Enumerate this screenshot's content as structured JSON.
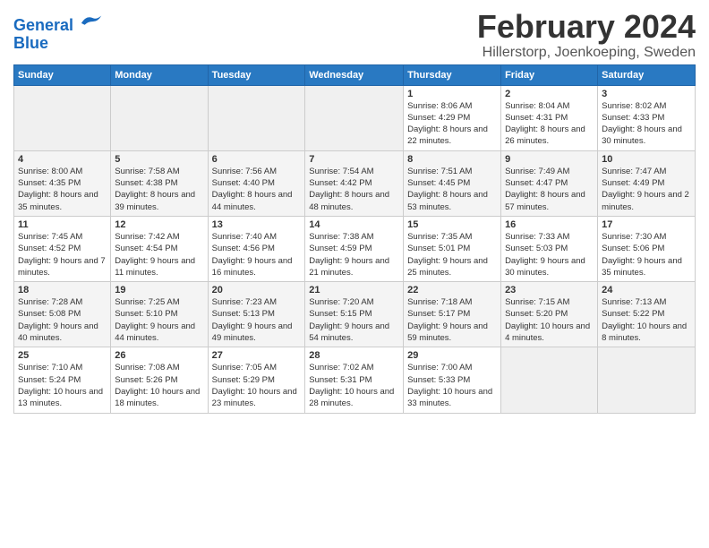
{
  "header": {
    "logo_line1": "General",
    "logo_line2": "Blue",
    "title": "February 2024",
    "subtitle": "Hillerstorp, Joenkoeping, Sweden"
  },
  "days_of_week": [
    "Sunday",
    "Monday",
    "Tuesday",
    "Wednesday",
    "Thursday",
    "Friday",
    "Saturday"
  ],
  "weeks": [
    [
      {
        "day": "",
        "sunrise": "",
        "sunset": "",
        "daylight": ""
      },
      {
        "day": "",
        "sunrise": "",
        "sunset": "",
        "daylight": ""
      },
      {
        "day": "",
        "sunrise": "",
        "sunset": "",
        "daylight": ""
      },
      {
        "day": "",
        "sunrise": "",
        "sunset": "",
        "daylight": ""
      },
      {
        "day": "1",
        "sunrise": "Sunrise: 8:06 AM",
        "sunset": "Sunset: 4:29 PM",
        "daylight": "Daylight: 8 hours and 22 minutes."
      },
      {
        "day": "2",
        "sunrise": "Sunrise: 8:04 AM",
        "sunset": "Sunset: 4:31 PM",
        "daylight": "Daylight: 8 hours and 26 minutes."
      },
      {
        "day": "3",
        "sunrise": "Sunrise: 8:02 AM",
        "sunset": "Sunset: 4:33 PM",
        "daylight": "Daylight: 8 hours and 30 minutes."
      }
    ],
    [
      {
        "day": "4",
        "sunrise": "Sunrise: 8:00 AM",
        "sunset": "Sunset: 4:35 PM",
        "daylight": "Daylight: 8 hours and 35 minutes."
      },
      {
        "day": "5",
        "sunrise": "Sunrise: 7:58 AM",
        "sunset": "Sunset: 4:38 PM",
        "daylight": "Daylight: 8 hours and 39 minutes."
      },
      {
        "day": "6",
        "sunrise": "Sunrise: 7:56 AM",
        "sunset": "Sunset: 4:40 PM",
        "daylight": "Daylight: 8 hours and 44 minutes."
      },
      {
        "day": "7",
        "sunrise": "Sunrise: 7:54 AM",
        "sunset": "Sunset: 4:42 PM",
        "daylight": "Daylight: 8 hours and 48 minutes."
      },
      {
        "day": "8",
        "sunrise": "Sunrise: 7:51 AM",
        "sunset": "Sunset: 4:45 PM",
        "daylight": "Daylight: 8 hours and 53 minutes."
      },
      {
        "day": "9",
        "sunrise": "Sunrise: 7:49 AM",
        "sunset": "Sunset: 4:47 PM",
        "daylight": "Daylight: 8 hours and 57 minutes."
      },
      {
        "day": "10",
        "sunrise": "Sunrise: 7:47 AM",
        "sunset": "Sunset: 4:49 PM",
        "daylight": "Daylight: 9 hours and 2 minutes."
      }
    ],
    [
      {
        "day": "11",
        "sunrise": "Sunrise: 7:45 AM",
        "sunset": "Sunset: 4:52 PM",
        "daylight": "Daylight: 9 hours and 7 minutes."
      },
      {
        "day": "12",
        "sunrise": "Sunrise: 7:42 AM",
        "sunset": "Sunset: 4:54 PM",
        "daylight": "Daylight: 9 hours and 11 minutes."
      },
      {
        "day": "13",
        "sunrise": "Sunrise: 7:40 AM",
        "sunset": "Sunset: 4:56 PM",
        "daylight": "Daylight: 9 hours and 16 minutes."
      },
      {
        "day": "14",
        "sunrise": "Sunrise: 7:38 AM",
        "sunset": "Sunset: 4:59 PM",
        "daylight": "Daylight: 9 hours and 21 minutes."
      },
      {
        "day": "15",
        "sunrise": "Sunrise: 7:35 AM",
        "sunset": "Sunset: 5:01 PM",
        "daylight": "Daylight: 9 hours and 25 minutes."
      },
      {
        "day": "16",
        "sunrise": "Sunrise: 7:33 AM",
        "sunset": "Sunset: 5:03 PM",
        "daylight": "Daylight: 9 hours and 30 minutes."
      },
      {
        "day": "17",
        "sunrise": "Sunrise: 7:30 AM",
        "sunset": "Sunset: 5:06 PM",
        "daylight": "Daylight: 9 hours and 35 minutes."
      }
    ],
    [
      {
        "day": "18",
        "sunrise": "Sunrise: 7:28 AM",
        "sunset": "Sunset: 5:08 PM",
        "daylight": "Daylight: 9 hours and 40 minutes."
      },
      {
        "day": "19",
        "sunrise": "Sunrise: 7:25 AM",
        "sunset": "Sunset: 5:10 PM",
        "daylight": "Daylight: 9 hours and 44 minutes."
      },
      {
        "day": "20",
        "sunrise": "Sunrise: 7:23 AM",
        "sunset": "Sunset: 5:13 PM",
        "daylight": "Daylight: 9 hours and 49 minutes."
      },
      {
        "day": "21",
        "sunrise": "Sunrise: 7:20 AM",
        "sunset": "Sunset: 5:15 PM",
        "daylight": "Daylight: 9 hours and 54 minutes."
      },
      {
        "day": "22",
        "sunrise": "Sunrise: 7:18 AM",
        "sunset": "Sunset: 5:17 PM",
        "daylight": "Daylight: 9 hours and 59 minutes."
      },
      {
        "day": "23",
        "sunrise": "Sunrise: 7:15 AM",
        "sunset": "Sunset: 5:20 PM",
        "daylight": "Daylight: 10 hours and 4 minutes."
      },
      {
        "day": "24",
        "sunrise": "Sunrise: 7:13 AM",
        "sunset": "Sunset: 5:22 PM",
        "daylight": "Daylight: 10 hours and 8 minutes."
      }
    ],
    [
      {
        "day": "25",
        "sunrise": "Sunrise: 7:10 AM",
        "sunset": "Sunset: 5:24 PM",
        "daylight": "Daylight: 10 hours and 13 minutes."
      },
      {
        "day": "26",
        "sunrise": "Sunrise: 7:08 AM",
        "sunset": "Sunset: 5:26 PM",
        "daylight": "Daylight: 10 hours and 18 minutes."
      },
      {
        "day": "27",
        "sunrise": "Sunrise: 7:05 AM",
        "sunset": "Sunset: 5:29 PM",
        "daylight": "Daylight: 10 hours and 23 minutes."
      },
      {
        "day": "28",
        "sunrise": "Sunrise: 7:02 AM",
        "sunset": "Sunset: 5:31 PM",
        "daylight": "Daylight: 10 hours and 28 minutes."
      },
      {
        "day": "29",
        "sunrise": "Sunrise: 7:00 AM",
        "sunset": "Sunset: 5:33 PM",
        "daylight": "Daylight: 10 hours and 33 minutes."
      },
      {
        "day": "",
        "sunrise": "",
        "sunset": "",
        "daylight": ""
      },
      {
        "day": "",
        "sunrise": "",
        "sunset": "",
        "daylight": ""
      }
    ]
  ]
}
